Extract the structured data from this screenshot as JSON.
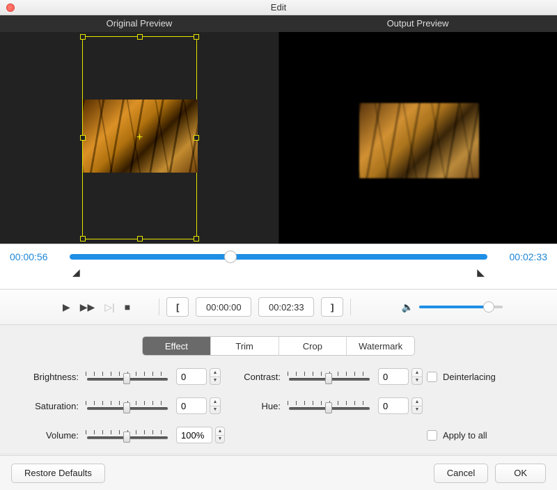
{
  "window": {
    "title": "Edit"
  },
  "preview_headers": {
    "original": "Original Preview",
    "output": "Output Preview"
  },
  "timeline": {
    "start": "00:00:56",
    "end": "00:02:33",
    "pos_percent": 37
  },
  "trim": {
    "in": "00:00:00",
    "out": "00:02:33"
  },
  "volume_slider_percent": 85,
  "tabs": {
    "effect": "Effect",
    "trim": "Trim",
    "crop": "Crop",
    "watermark": "Watermark",
    "active": "effect"
  },
  "effects": {
    "brightness": {
      "label": "Brightness:",
      "value": "0",
      "pos": 45
    },
    "contrast": {
      "label": "Contrast:",
      "value": "0",
      "pos": 45
    },
    "saturation": {
      "label": "Saturation:",
      "value": "0",
      "pos": 45
    },
    "hue": {
      "label": "Hue:",
      "value": "0",
      "pos": 45
    },
    "volume": {
      "label": "Volume:",
      "value": "100%",
      "pos": 45
    }
  },
  "checkboxes": {
    "deinterlacing": "Deinterlacing",
    "apply_all": "Apply to all"
  },
  "footer": {
    "restore": "Restore Defaults",
    "cancel": "Cancel",
    "ok": "OK"
  }
}
